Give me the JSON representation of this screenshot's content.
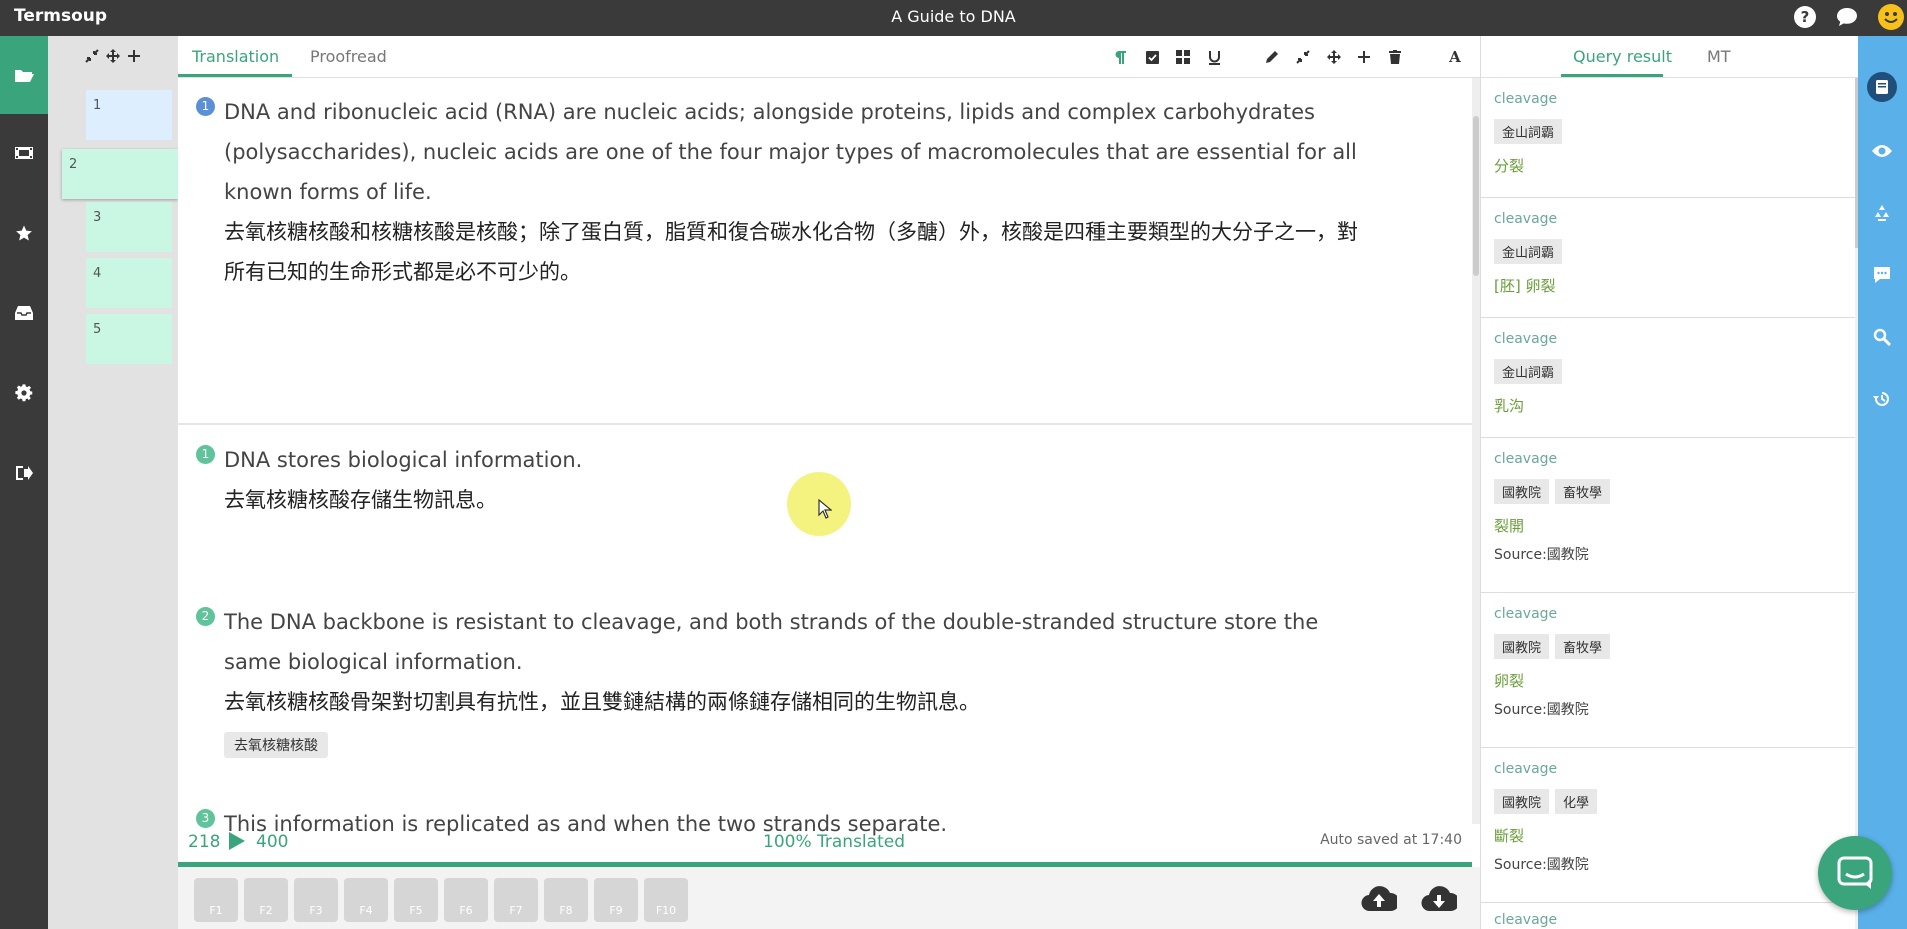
{
  "app": {
    "brand": "Termsoup",
    "title": "A Guide to DNA"
  },
  "topbar_icons": [
    "help-icon",
    "chat-icon",
    "smiley-icon"
  ],
  "nav": {
    "items": [
      "folder-open-icon",
      "film-icon",
      "star-icon",
      "inbox-icon",
      "gear-icon",
      "sign-out-icon"
    ],
    "active": "folder-open-icon"
  },
  "pages": {
    "tools": [
      "compress-icon",
      "move-icon",
      "plus-icon"
    ],
    "items": [
      {
        "label": "1"
      },
      {
        "label": "2"
      },
      {
        "label": "3"
      },
      {
        "label": "4"
      },
      {
        "label": "5"
      }
    ],
    "active_index": 1
  },
  "editor": {
    "tabs": [
      "Translation",
      "Proofread"
    ],
    "active_tab": "Translation",
    "tools": [
      "paragraph-icon",
      "check-square-icon",
      "grid-icon",
      "underline-icon",
      "pencil-icon",
      "compress-icon",
      "move-icon",
      "plus-icon",
      "trash-icon",
      "font-icon"
    ],
    "source_segment": {
      "num": "1",
      "en": "DNA and ribonucleic acid (RNA) are nucleic acids; alongside proteins, lipids and complex carbohydrates (polysaccharides), nucleic acids are one of the four major types of macromolecules that are essential for all known forms of life.",
      "zh": "去氧核糖核酸和核糖核酸是核酸；除了蛋白質，脂質和復合碳水化合物（多醣）外，核酸是四種主要類型的大分子之一，對所有已知的生命形式都是必不可少的。"
    },
    "segments": [
      {
        "num": "1",
        "en": "DNA stores biological information.",
        "zh": "去氧核糖核酸存儲生物訊息。"
      },
      {
        "num": "2",
        "en": "The DNA backbone is resistant to cleavage, and both strands of the double-stranded structure store the same biological information.",
        "zh": "去氧核糖核酸骨架對切割具有抗性，並且雙鏈結構的兩條鏈存儲相同的生物訊息。",
        "tag": "去氧核糖核酸"
      },
      {
        "num": "3",
        "en": "This information is replicated as and when the two strands separate."
      }
    ],
    "status": {
      "translated_words": "218",
      "total_words": "400",
      "progress": "100% Translated",
      "saved": "Auto saved at 17:40"
    },
    "fkeys": [
      "F1",
      "F2",
      "F3",
      "F4",
      "F5",
      "F6",
      "F7",
      "F8",
      "F9",
      "F10"
    ],
    "actions": [
      "cloud-upload-icon",
      "cloud-download-icon"
    ]
  },
  "query": {
    "tabs": [
      "Query result",
      "MT"
    ],
    "active_tab": "Query result",
    "results": [
      {
        "term": "cleavage",
        "dicts": [
          "金山詞霸"
        ],
        "translation": "分裂"
      },
      {
        "term": "cleavage",
        "dicts": [
          "金山詞霸"
        ],
        "translation": "[胚] 卵裂"
      },
      {
        "term": "cleavage",
        "dicts": [
          "金山詞霸"
        ],
        "translation": "乳沟"
      },
      {
        "term": "cleavage",
        "dicts": [
          "國教院",
          "畜牧學"
        ],
        "translation": "裂開",
        "source": "Source:國教院"
      },
      {
        "term": "cleavage",
        "dicts": [
          "國教院",
          "畜牧學"
        ],
        "translation": "卵裂",
        "source": "Source:國教院"
      },
      {
        "term": "cleavage",
        "dicts": [
          "國教院",
          "化學"
        ],
        "translation": "斷裂",
        "source": "Source:國教院"
      },
      {
        "term": "cleavage"
      }
    ]
  },
  "rightnav": [
    "book-icon",
    "eye-icon",
    "recycle-icon",
    "comment-icon",
    "search-icon",
    "history-icon"
  ],
  "colors": {
    "accent": "#3aa57c",
    "dark": "#3a3a3a",
    "side_blue": "#5ab0e8",
    "num_blue": "#5b8fd6",
    "num_green": "#5fc39b"
  }
}
